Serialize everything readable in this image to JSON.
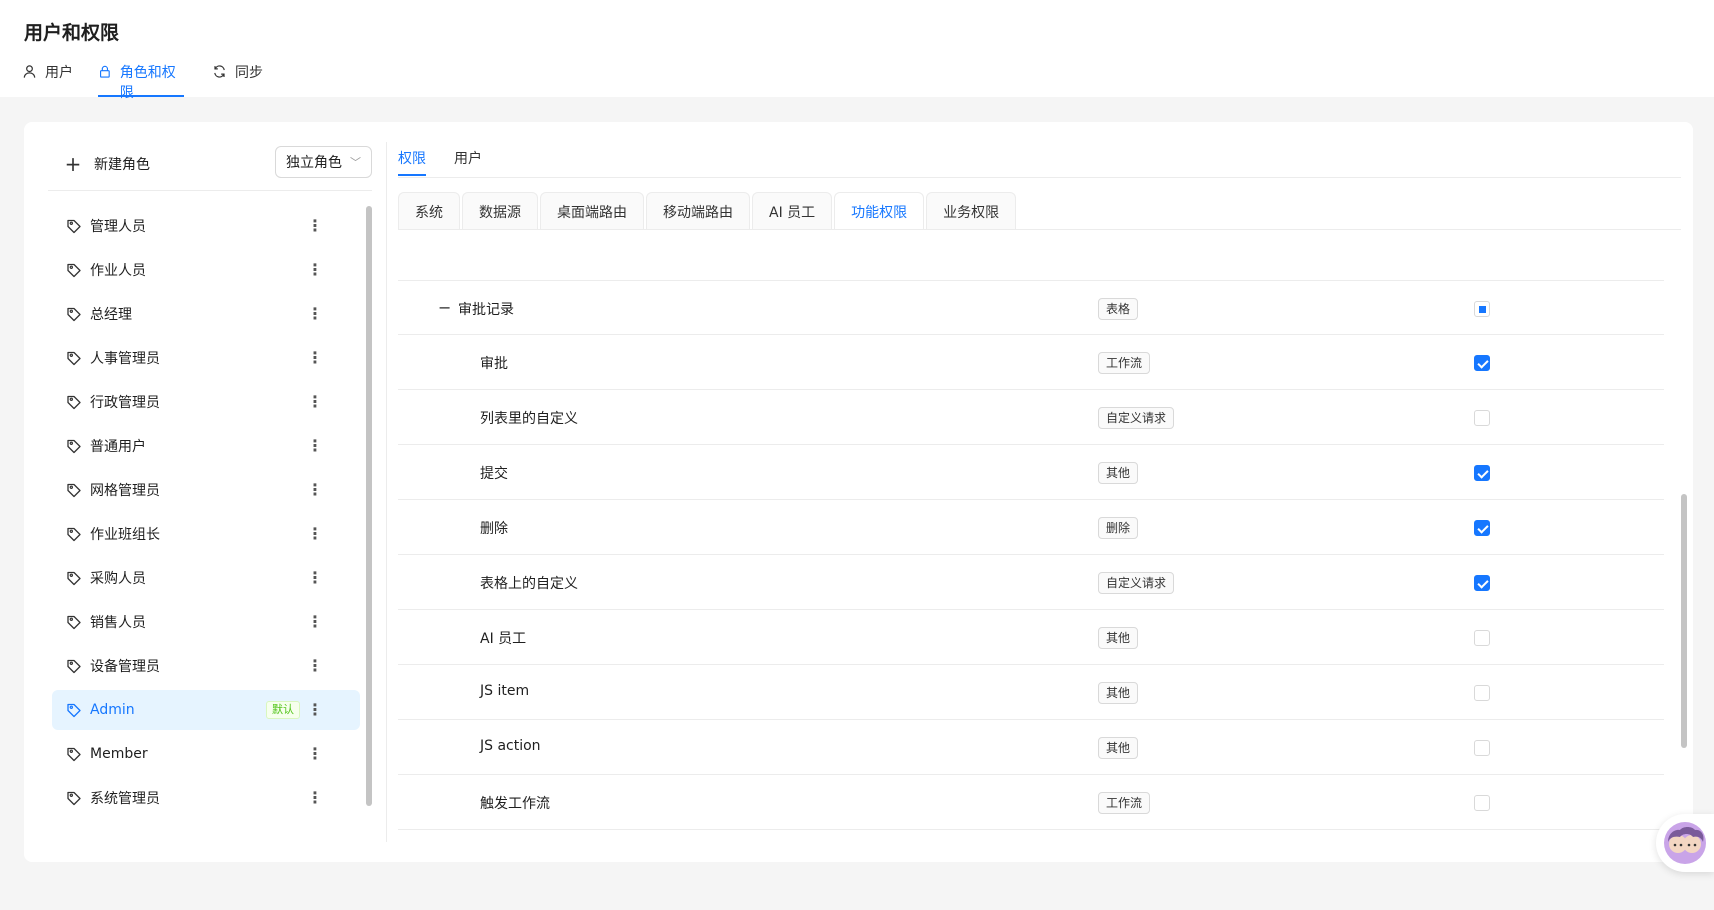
{
  "header": {
    "title": "用户和权限",
    "tabs": [
      {
        "label": "用户",
        "icon": "user-icon"
      },
      {
        "label": "角色和权限",
        "icon": "lock-icon",
        "active": true
      },
      {
        "label": "同步",
        "icon": "sync-icon"
      }
    ]
  },
  "roles_panel": {
    "new_role_label": "新建角色",
    "role_mode": "独立角色",
    "default_badge": "默认",
    "roles": [
      {
        "label": "管理人员"
      },
      {
        "label": "作业人员"
      },
      {
        "label": "总经理"
      },
      {
        "label": "人事管理员"
      },
      {
        "label": "行政管理员"
      },
      {
        "label": "普通用户"
      },
      {
        "label": "网格管理员"
      },
      {
        "label": "作业班组长"
      },
      {
        "label": "采购人员"
      },
      {
        "label": "销售人员"
      },
      {
        "label": "设备管理员"
      },
      {
        "label": "Admin",
        "selected": true,
        "default": true
      },
      {
        "label": "Member"
      },
      {
        "label": "系统管理员"
      }
    ]
  },
  "detail": {
    "sub_tabs": [
      {
        "label": "权限",
        "active": true
      },
      {
        "label": "用户"
      }
    ],
    "card_tabs": [
      {
        "label": "系统"
      },
      {
        "label": "数据源"
      },
      {
        "label": "桌面端路由"
      },
      {
        "label": "移动端路由"
      },
      {
        "label": "AI 员工"
      },
      {
        "label": "功能权限",
        "active": true
      },
      {
        "label": "业务权限"
      }
    ],
    "permission_rows": [
      {
        "name": "审批记录",
        "type": "表格",
        "state": "indeterminate",
        "level": 0,
        "collapse": "−"
      },
      {
        "name": "审批",
        "type": "工作流",
        "state": "checked",
        "level": 1
      },
      {
        "name": "列表里的自定义",
        "type": "自定义请求",
        "state": "unchecked",
        "level": 1
      },
      {
        "name": "提交",
        "type": "其他",
        "state": "checked",
        "level": 1
      },
      {
        "name": "删除",
        "type": "删除",
        "state": "checked",
        "level": 1
      },
      {
        "name": "表格上的自定义",
        "type": "自定义请求",
        "state": "checked",
        "level": 1
      },
      {
        "name": "AI 员工",
        "type": "其他",
        "state": "unchecked",
        "level": 1
      },
      {
        "name": "JS item",
        "type": "其他",
        "state": "unchecked",
        "level": 1
      },
      {
        "name": "JS action",
        "type": "其他",
        "state": "unchecked",
        "level": 1
      },
      {
        "name": "触发工作流",
        "type": "工作流",
        "state": "unchecked",
        "level": 1
      }
    ]
  },
  "colors": {
    "accent": "#1677ff",
    "selected_bg": "#e6f4ff",
    "badge_green": "#52c41a"
  }
}
